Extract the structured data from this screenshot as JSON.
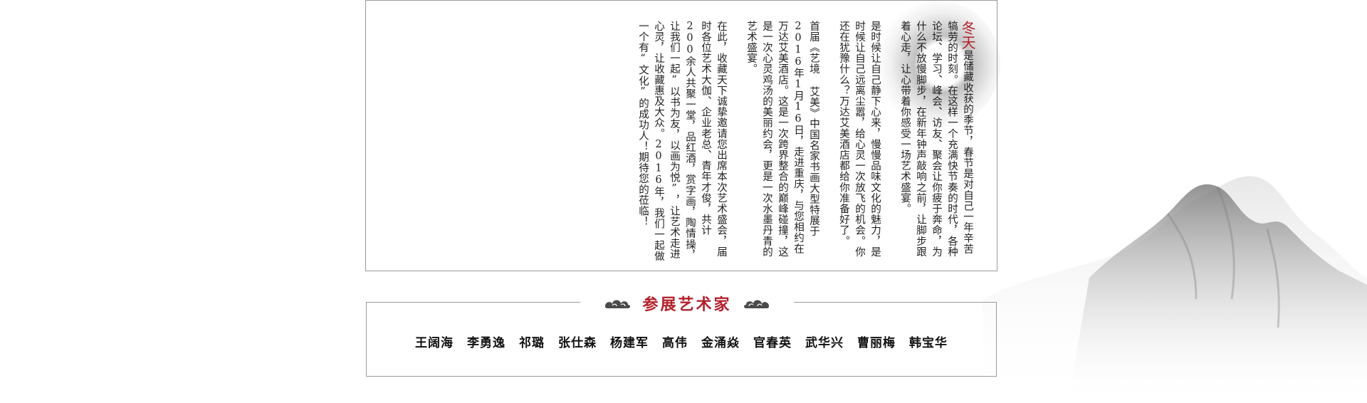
{
  "intro": {
    "lead": "冬天",
    "paragraphs": [
      "是储藏收获的季节，春节是对自己一年辛苦犒劳的时刻。在这样一个充满快节奏的时代，各种论坛、学习、峰会、访友、聚会让你疲于奔命，为什么不放慢脚步，在新年钟声敲响之前，让脚步跟着心走，让心带着你感受一场艺术盛宴。",
      "是时候让自己静下心来，慢慢品味文化的魅力，是时候让自己远离尘嚣，给心灵一次放飞的机会。你还在犹豫什么？万达艾美酒店都给你准备好了。",
      "首届《艺境 艾美》中国名家书画大型特展于2016年1月16日，走进重庆，与您相约在万达艾美酒店。这是一次跨界整合的巅峰碰撞，这是一次心灵鸡汤的美丽约会，更是一次水墨丹青的艺术盛宴。",
      "在此，收藏天下诚挚邀请您出席本次艺术盛会，届时各位艺术大伽、企业老总、青年才俊，共计200余人共聚一堂，品红酒，赏字画，陶情操，让我们一起“以书为友，以画为悦”，让艺术走进心灵，让收藏惠及大众。2016年，我们一起做一个有“文化”的成功人！期待您的莅临！"
    ]
  },
  "artists_section": {
    "title": "参展艺术家",
    "artists": [
      "王阔海",
      "李勇逸",
      "祁璐",
      "张仕森",
      "杨建军",
      "高伟",
      "金涌焱",
      "官春英",
      "武华兴",
      "曹丽梅",
      "韩宝华"
    ]
  },
  "icons": {
    "left_ornament": "auspicious-cloud-icon",
    "right_ornament": "auspicious-cloud-icon"
  },
  "colors": {
    "accent": "#b3202a",
    "border": "#9a9a9a"
  }
}
